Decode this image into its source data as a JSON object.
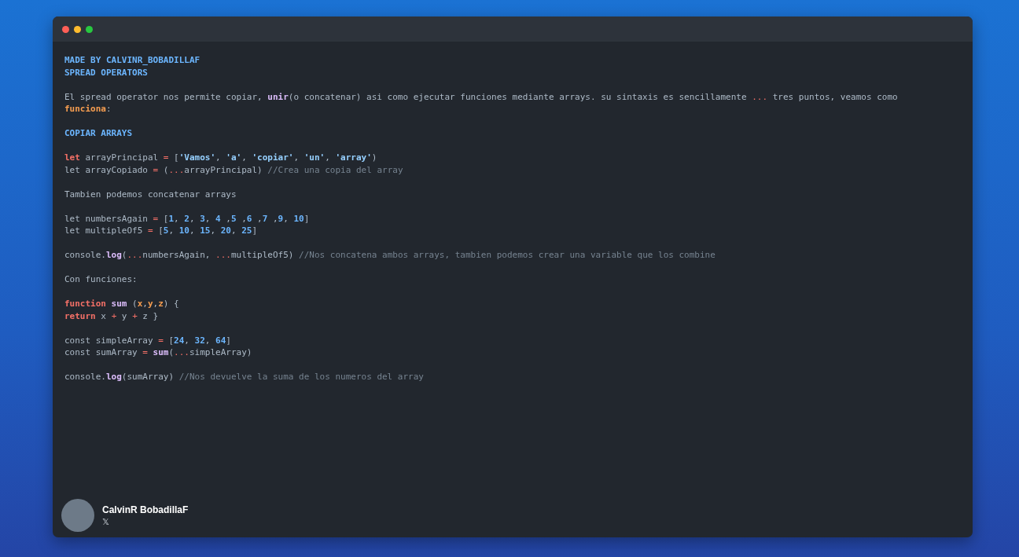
{
  "blocks": [
    {
      "lines": [
        [
          {
            "t": "MADE BY CALVINR_BOBADILLAF",
            "kind": "heading"
          }
        ],
        [
          {
            "t": "SPREAD OPERATORS",
            "kind": "heading"
          }
        ]
      ]
    },
    {
      "lines": [
        [
          {
            "t": "El spread operator nos permite copiar, ",
            "kind": "plain"
          },
          {
            "t": "unir",
            "kind": "func"
          },
          {
            "t": "(o concatenar) asi como ejecutar funciones mediante arrays. su sintaxis es sencillamente ",
            "kind": "plain"
          },
          {
            "t": "...",
            "kind": "op"
          },
          {
            "t": " tres puntos, veamos como ",
            "kind": "plain"
          },
          {
            "t": "funciona",
            "kind": "param"
          },
          {
            "t": ":",
            "kind": "plain"
          }
        ]
      ]
    },
    {
      "lines": [
        [
          {
            "t": "COPIAR ARRAYS",
            "kind": "heading"
          }
        ]
      ]
    },
    {
      "lines": [
        [
          {
            "t": "let",
            "kind": "kw"
          },
          {
            "t": " arrayPrincipal ",
            "kind": "plain"
          },
          {
            "t": "=",
            "kind": "op"
          },
          {
            "t": " [",
            "kind": "plain"
          },
          {
            "t": "'Vamos'",
            "kind": "str"
          },
          {
            "t": ", ",
            "kind": "plain"
          },
          {
            "t": "'a'",
            "kind": "str"
          },
          {
            "t": ", ",
            "kind": "plain"
          },
          {
            "t": "'copiar'",
            "kind": "str"
          },
          {
            "t": ", ",
            "kind": "plain"
          },
          {
            "t": "'un'",
            "kind": "str"
          },
          {
            "t": ", ",
            "kind": "plain"
          },
          {
            "t": "'array'",
            "kind": "str"
          },
          {
            "t": ")",
            "kind": "plain"
          }
        ],
        [
          {
            "t": "let arrayCopiado ",
            "kind": "plain"
          },
          {
            "t": "=",
            "kind": "op"
          },
          {
            "t": " (",
            "kind": "plain"
          },
          {
            "t": "...",
            "kind": "op"
          },
          {
            "t": "arrayPrincipal) ",
            "kind": "plain"
          },
          {
            "t": "//Crea una copia del array",
            "kind": "comment"
          }
        ]
      ]
    },
    {
      "lines": [
        [
          {
            "t": "Tambien podemos concatenar arrays",
            "kind": "plain"
          }
        ]
      ]
    },
    {
      "lines": [
        [
          {
            "t": "let numbersAgain ",
            "kind": "plain"
          },
          {
            "t": "=",
            "kind": "op"
          },
          {
            "t": " [",
            "kind": "plain"
          },
          {
            "t": "1",
            "kind": "num"
          },
          {
            "t": ", ",
            "kind": "plain"
          },
          {
            "t": "2",
            "kind": "num"
          },
          {
            "t": ", ",
            "kind": "plain"
          },
          {
            "t": "3",
            "kind": "num"
          },
          {
            "t": ", ",
            "kind": "plain"
          },
          {
            "t": "4",
            "kind": "num"
          },
          {
            "t": " ,",
            "kind": "plain"
          },
          {
            "t": "5",
            "kind": "num"
          },
          {
            "t": " ,",
            "kind": "plain"
          },
          {
            "t": "6",
            "kind": "num"
          },
          {
            "t": " ,",
            "kind": "plain"
          },
          {
            "t": "7",
            "kind": "num"
          },
          {
            "t": " ,",
            "kind": "plain"
          },
          {
            "t": "9",
            "kind": "num"
          },
          {
            "t": ", ",
            "kind": "plain"
          },
          {
            "t": "10",
            "kind": "num"
          },
          {
            "t": "]",
            "kind": "plain"
          }
        ],
        [
          {
            "t": "let multipleOf5 ",
            "kind": "plain"
          },
          {
            "t": "=",
            "kind": "op"
          },
          {
            "t": " [",
            "kind": "plain"
          },
          {
            "t": "5",
            "kind": "num"
          },
          {
            "t": ", ",
            "kind": "plain"
          },
          {
            "t": "10",
            "kind": "num"
          },
          {
            "t": ", ",
            "kind": "plain"
          },
          {
            "t": "15",
            "kind": "num"
          },
          {
            "t": ", ",
            "kind": "plain"
          },
          {
            "t": "20",
            "kind": "num"
          },
          {
            "t": ", ",
            "kind": "plain"
          },
          {
            "t": "25",
            "kind": "num"
          },
          {
            "t": "]",
            "kind": "plain"
          }
        ]
      ]
    },
    {
      "lines": [
        [
          {
            "t": "console.",
            "kind": "plain"
          },
          {
            "t": "log",
            "kind": "func"
          },
          {
            "t": "(",
            "kind": "plain"
          },
          {
            "t": "...",
            "kind": "op"
          },
          {
            "t": "numbersAgain, ",
            "kind": "plain"
          },
          {
            "t": "...",
            "kind": "op"
          },
          {
            "t": "multipleOf5) ",
            "kind": "plain"
          },
          {
            "t": "//Nos concatena ambos arrays, tambien podemos crear una variable que los combine",
            "kind": "comment"
          }
        ]
      ]
    },
    {
      "lines": [
        [
          {
            "t": "Con funciones:",
            "kind": "plain"
          }
        ]
      ]
    },
    {
      "lines": [
        [
          {
            "t": "function ",
            "kind": "kw"
          },
          {
            "t": "sum",
            "kind": "func"
          },
          {
            "t": " (",
            "kind": "plain"
          },
          {
            "t": "x",
            "kind": "param"
          },
          {
            "t": ",",
            "kind": "plain"
          },
          {
            "t": "y",
            "kind": "param"
          },
          {
            "t": ",",
            "kind": "plain"
          },
          {
            "t": "z",
            "kind": "param"
          },
          {
            "t": ") {",
            "kind": "plain"
          }
        ],
        [
          {
            "t": "return",
            "kind": "kw"
          },
          {
            "t": " x ",
            "kind": "plain"
          },
          {
            "t": "+",
            "kind": "op"
          },
          {
            "t": " y ",
            "kind": "plain"
          },
          {
            "t": "+",
            "kind": "op"
          },
          {
            "t": " z }",
            "kind": "plain"
          }
        ]
      ]
    },
    {
      "lines": [
        [
          {
            "t": "const simpleArray ",
            "kind": "plain"
          },
          {
            "t": "=",
            "kind": "op"
          },
          {
            "t": " [",
            "kind": "plain"
          },
          {
            "t": "24",
            "kind": "num"
          },
          {
            "t": ", ",
            "kind": "plain"
          },
          {
            "t": "32",
            "kind": "num"
          },
          {
            "t": ", ",
            "kind": "plain"
          },
          {
            "t": "64",
            "kind": "num"
          },
          {
            "t": "]",
            "kind": "plain"
          }
        ],
        [
          {
            "t": "const sumArray ",
            "kind": "plain"
          },
          {
            "t": "= ",
            "kind": "op"
          },
          {
            "t": "sum",
            "kind": "func"
          },
          {
            "t": "(",
            "kind": "plain"
          },
          {
            "t": "...",
            "kind": "op"
          },
          {
            "t": "simpleArray)",
            "kind": "plain"
          }
        ]
      ]
    },
    {
      "lines": [
        [
          {
            "t": "console.",
            "kind": "plain"
          },
          {
            "t": "log",
            "kind": "func"
          },
          {
            "t": "(sumArray) ",
            "kind": "plain"
          },
          {
            "t": "//Nos devuelve la suma de los numeros del array",
            "kind": "comment"
          }
        ]
      ]
    }
  ],
  "author": {
    "name": "CalvinR BobadillaF",
    "handle": "𝕏"
  }
}
